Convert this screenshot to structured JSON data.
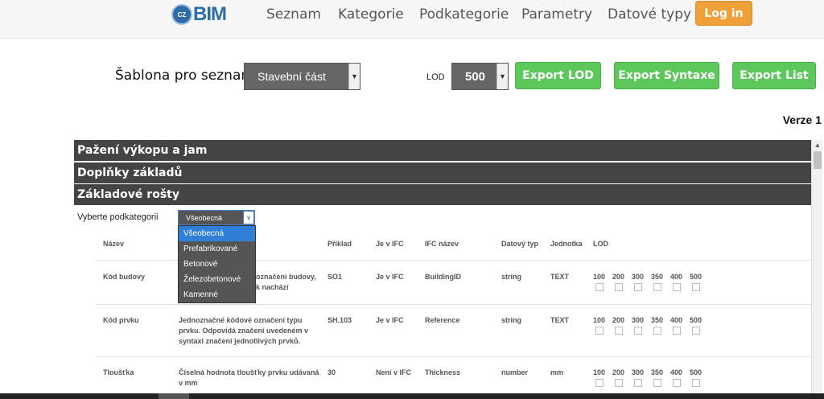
{
  "logo": {
    "badge": "CZ",
    "text": "BIM"
  },
  "nav": {
    "items": [
      "Seznam",
      "Kategorie",
      "Podkategorie",
      "Parametry",
      "Datové typy"
    ],
    "login": "Log in"
  },
  "controls": {
    "template_label": "Šablona pro seznam",
    "template_value": "Stavební část",
    "lod_label": "LOD",
    "lod_value": "500",
    "export_lod": "Export LOD",
    "export_syntax": "Export Syntaxe",
    "export_list": "Export List"
  },
  "version": "Verze 1",
  "categories": [
    "Pažení výkopu a jam",
    "Doplňky základů",
    "Základové rošty"
  ],
  "subcategory": {
    "label": "Vyberte podkategorii",
    "selected": "Všeobecná",
    "options": [
      "Všeobecná",
      "Prefabrikované",
      "Betonové",
      "Železobetonové",
      "Kamenné"
    ]
  },
  "table": {
    "headers": {
      "name": "Název",
      "example": "Příklad",
      "in_ifc": "Je v IFC",
      "ifc_name": "IFC název",
      "data_type": "Datový typ",
      "unit": "Jednotka",
      "lod": "LOD"
    },
    "lod_levels": [
      "100",
      "200",
      "300",
      "350",
      "400",
      "500"
    ],
    "rows": [
      {
        "name": "Kód budovy",
        "desc_line1": "označení budovy,",
        "desc_line2": "k nachází",
        "example": "SO1",
        "in_ifc": "Je v IFC",
        "ifc_name": "BuildingID",
        "data_type": "string",
        "unit": "TEXT"
      },
      {
        "name": "Kód prvku",
        "desc_line1": "Jednoznačné kódové označení typu",
        "desc_line2": "prvku. Odpovídá značení uvedeném v",
        "desc_line3": "syntaxi značení jednotlivých prvků.",
        "example": "SH.103",
        "in_ifc": "Je v IFC",
        "ifc_name": "Reference",
        "data_type": "string",
        "unit": "TEXT"
      },
      {
        "name": "Tloušťka",
        "desc_line1": "Číselná hodnota tloušťky prvku udávaná",
        "desc_line2": "v mm",
        "example": "30",
        "in_ifc": "Není v IFC",
        "ifc_name": "Thickness",
        "data_type": "number",
        "unit": "mm"
      }
    ]
  }
}
